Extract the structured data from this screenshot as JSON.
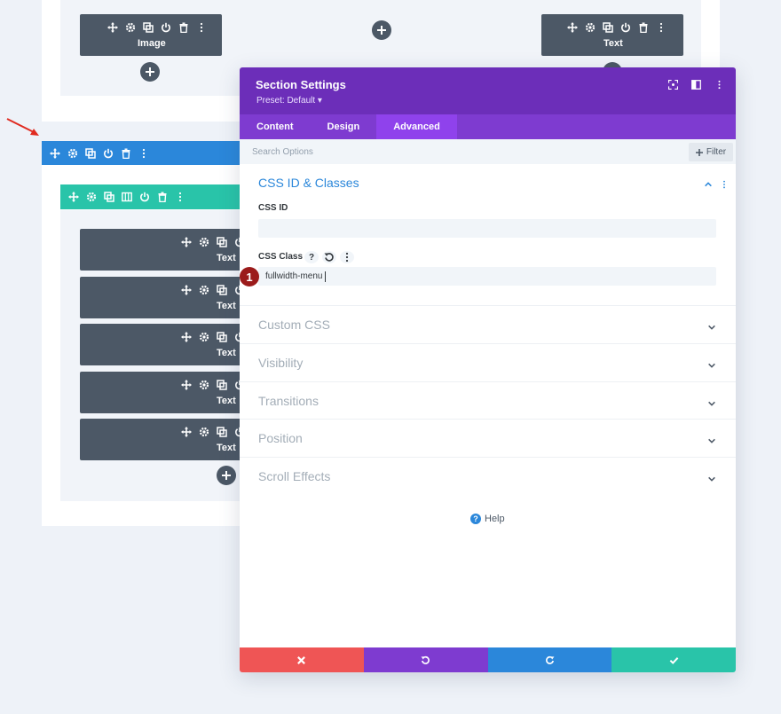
{
  "canvas": {
    "top_row": {
      "left_module_label": "Image",
      "right_module_label": "Text"
    },
    "column_modules": [
      {
        "label": "Text"
      },
      {
        "label": "Text"
      },
      {
        "label": "Text"
      },
      {
        "label": "Text"
      },
      {
        "label": "Text"
      }
    ]
  },
  "modal": {
    "title": "Section Settings",
    "preset": "Preset: Default ▾",
    "tabs": [
      "Content",
      "Design",
      "Advanced"
    ],
    "active_tab": "Advanced",
    "search": {
      "placeholder": "Search Options"
    },
    "filter_label": "Filter",
    "group": {
      "title": "CSS ID & Classes",
      "css_id": {
        "label": "CSS ID",
        "value": ""
      },
      "css_class": {
        "label": "CSS Class",
        "value": "fullwidth-menu",
        "help_glyph": "?"
      },
      "step_badge": "1"
    },
    "toggles": [
      "Custom CSS",
      "Visibility",
      "Transitions",
      "Position",
      "Scroll Effects"
    ],
    "help_label": "Help"
  },
  "colors": {
    "header": "#6c2eb9",
    "tab_bar": "#7e3bd0",
    "active_tab": "#8f42ec",
    "section_bar": "#2b87da",
    "row_bar": "#29c4a9",
    "module": "#4c5866",
    "cancel": "#ef5555",
    "undo": "#7e3bd0",
    "redo": "#2b87da",
    "save": "#29c4a9"
  }
}
